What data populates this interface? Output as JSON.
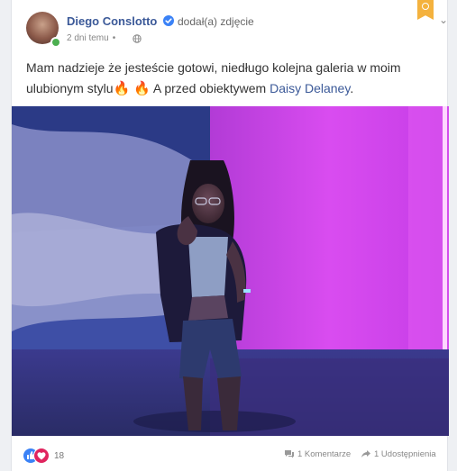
{
  "post": {
    "author": "Diego Conslotto",
    "action": "dodał(a) zdjęcie",
    "time": "2 dni temu",
    "text_before": "Mam nadzieje że jesteście gotowi, niedługo kolejna galeria w moim ulubionym stylu",
    "text_middle": "A przed obiektywem",
    "mention": "Daisy Delaney",
    "text_end": ".",
    "emoji": "🔥"
  },
  "footer": {
    "reaction_count": "18",
    "comments_label": "1 Komentarze",
    "shares_label": "1 Udostępnienia"
  },
  "colors": {
    "link": "#3b5998",
    "bookmark": "#f4b23e",
    "online": "#4caf50"
  }
}
